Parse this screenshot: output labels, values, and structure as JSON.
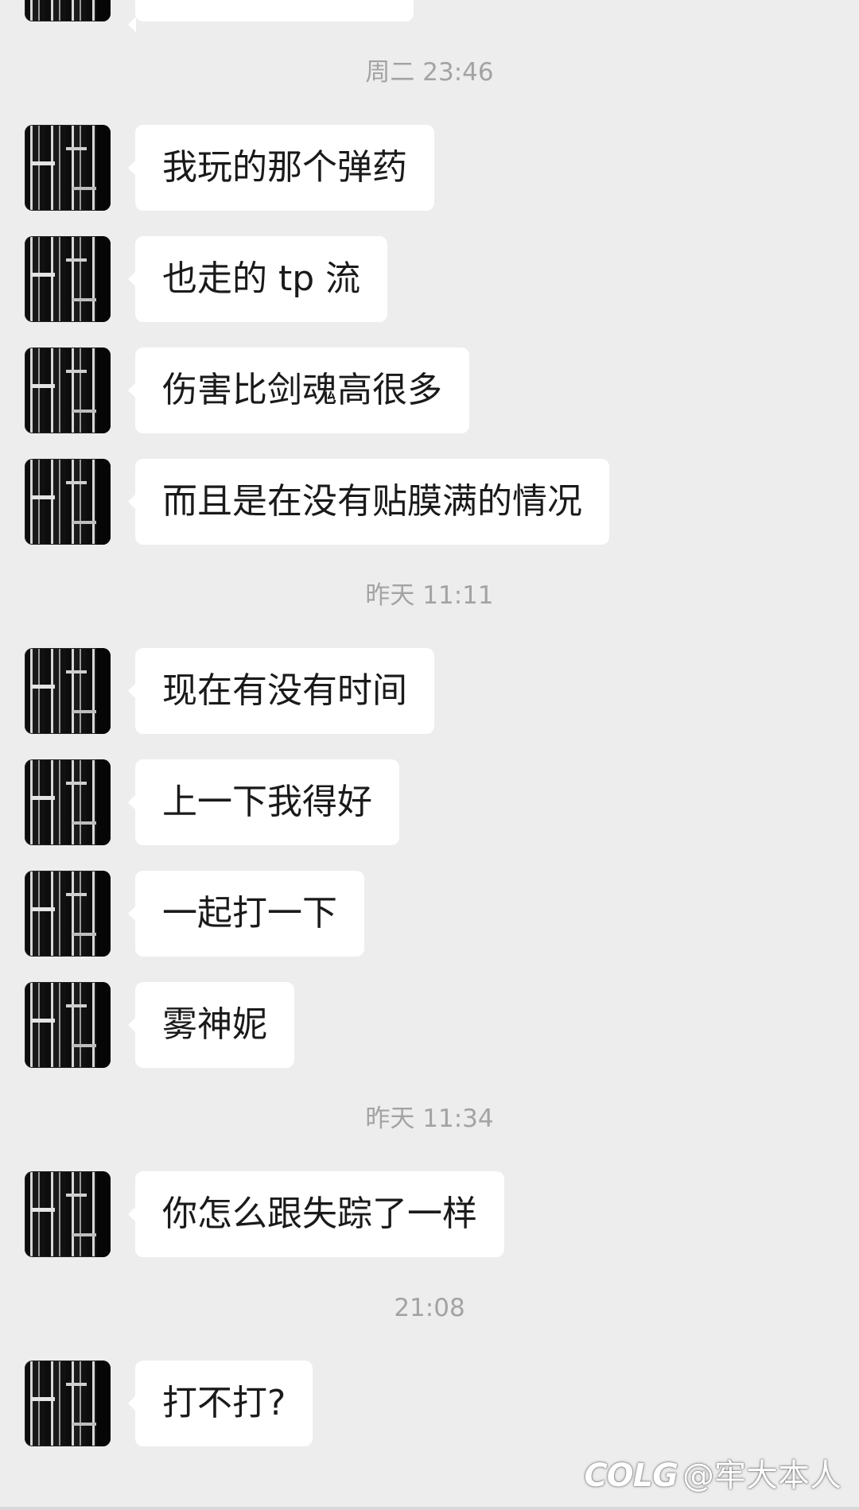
{
  "chat": {
    "groups": [
      {
        "timestamp": "周二 23:46",
        "messages": [
          "我玩的那个弹药",
          "也走的 tp 流",
          "伤害比剑魂高很多",
          "而且是在没有贴膜满的情况"
        ]
      },
      {
        "timestamp": "昨天 11:11",
        "messages": [
          "现在有没有时间",
          "上一下我得好",
          "一起打一下",
          "雾神妮"
        ]
      },
      {
        "timestamp": "昨天 11:34",
        "messages": [
          "你怎么跟失踪了一样"
        ]
      },
      {
        "timestamp": "21:08",
        "messages": [
          "打不打?"
        ]
      }
    ]
  },
  "watermark": {
    "logo": "COLG",
    "handle": "@牢大本人"
  }
}
